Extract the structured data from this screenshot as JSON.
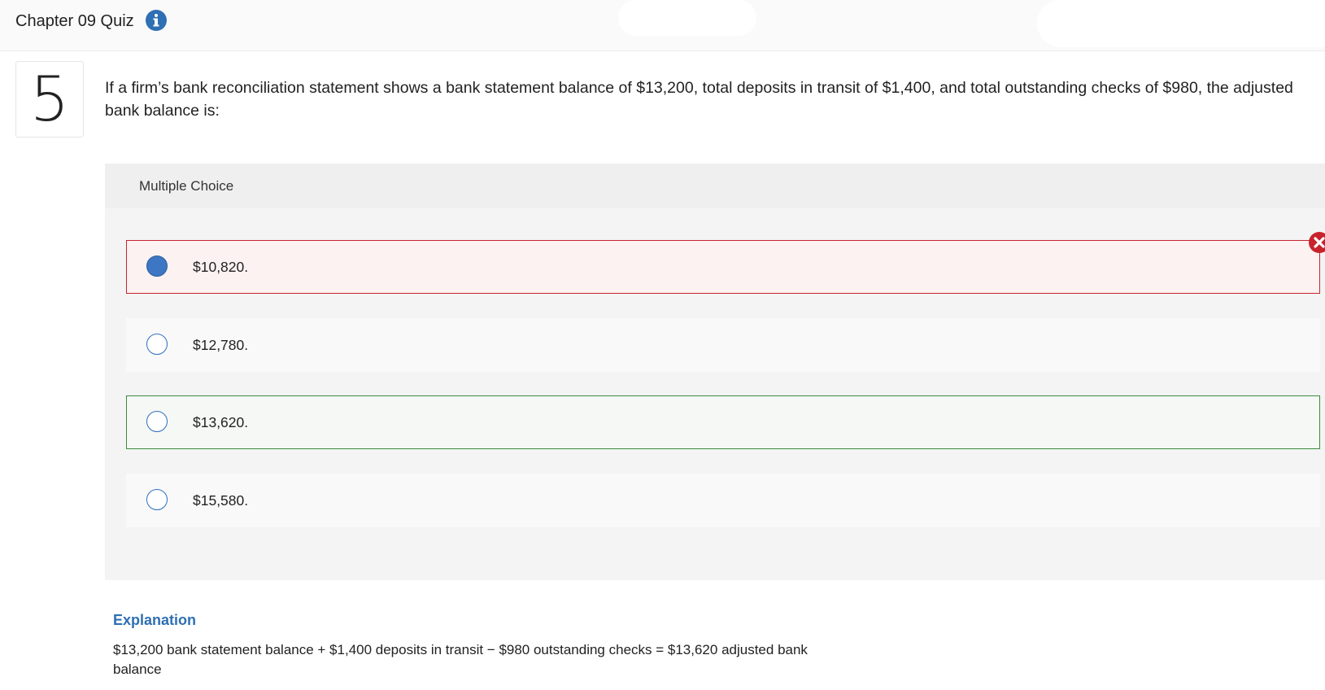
{
  "header": {
    "title": "Chapter 09 Quiz",
    "info_icon": "info-icon"
  },
  "question": {
    "number": "5",
    "text": "If a firm’s bank reconciliation statement shows a bank statement balance of $13,200, total deposits in transit of $1,400, and total outstanding checks of $980, the adjusted bank balance is:"
  },
  "multiple_choice": {
    "label": "Multiple Choice",
    "options": [
      {
        "text": "$10,820.",
        "state": "selected-incorrect"
      },
      {
        "text": "$12,780.",
        "state": "unselected"
      },
      {
        "text": "$13,620.",
        "state": "correct-answer"
      },
      {
        "text": "$15,580.",
        "state": "unselected"
      }
    ]
  },
  "explanation": {
    "title": "Explanation",
    "text": "$13,200 bank statement balance + $1,400 deposits in transit − $980 outstanding checks = $13,620 adjusted bank balance"
  },
  "colors": {
    "accent_blue": "#2f6fb3",
    "wrong_red": "#c8232c",
    "correct_green": "#3d8b3d",
    "selected_radio": "#3d76c2"
  }
}
